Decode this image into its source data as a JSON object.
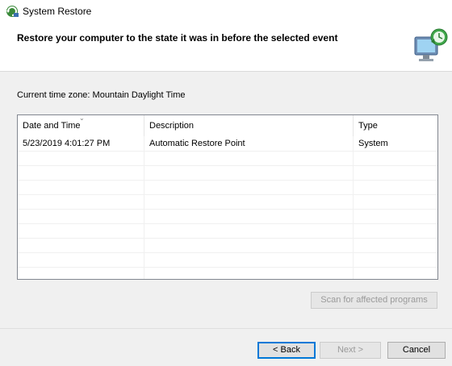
{
  "window": {
    "title": "System Restore",
    "icon": "system-restore-icon"
  },
  "header": {
    "heading": "Restore your computer to the state it was in before the selected event",
    "icon": "monitor-restore-icon"
  },
  "timezone_label": "Current time zone: Mountain Daylight Time",
  "table": {
    "columns": [
      "Date and Time",
      "Description",
      "Type"
    ],
    "sorted_column": "Date and Time",
    "rows": [
      {
        "date": "5/23/2019 4:01:27 PM",
        "description": "Automatic Restore Point",
        "type": "System"
      }
    ]
  },
  "buttons": {
    "scan": "Scan for affected programs",
    "back": "< Back",
    "next": "Next >",
    "cancel": "Cancel"
  },
  "colors": {
    "accent": "#0078d7",
    "header_bg": "#ffffff",
    "body_bg": "#f0f0f0"
  }
}
